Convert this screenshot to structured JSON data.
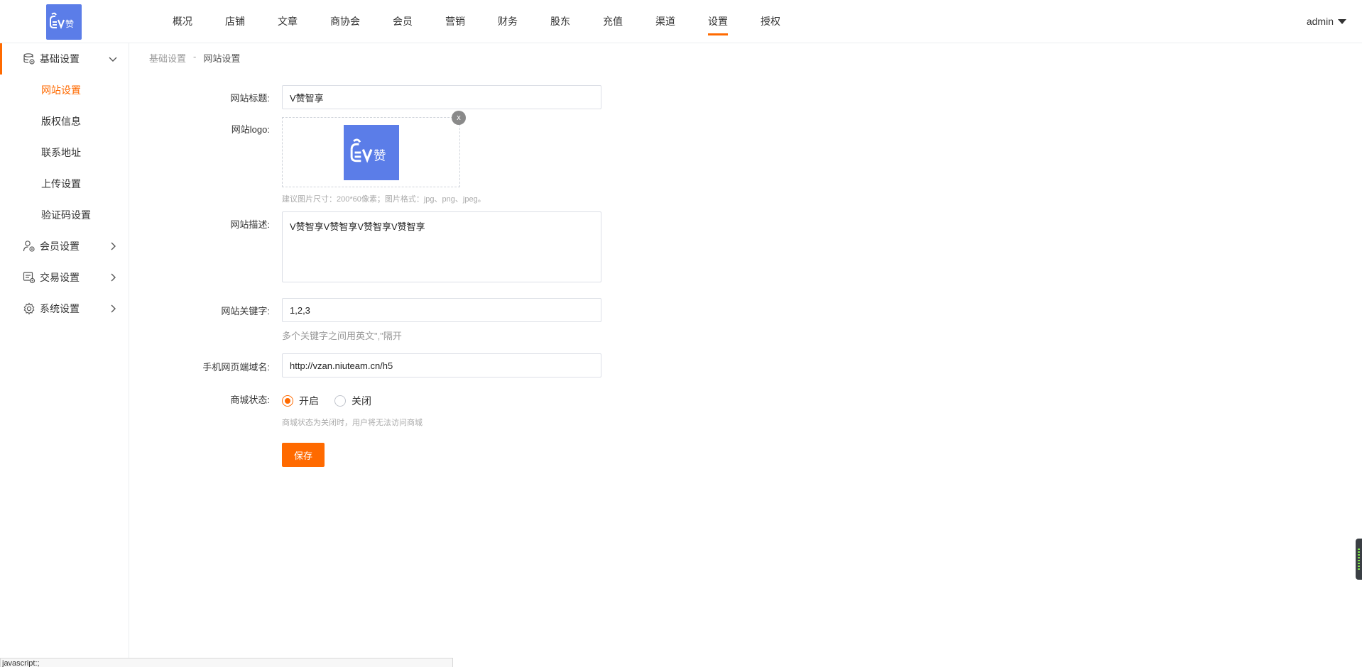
{
  "header": {
    "logo_text": "赞",
    "nav": [
      "概况",
      "店铺",
      "文章",
      "商协会",
      "会员",
      "营销",
      "财务",
      "股东",
      "充值",
      "渠道",
      "设置",
      "授权"
    ],
    "active_nav_index": 10,
    "user": "admin"
  },
  "sidebar": {
    "groups": [
      {
        "label": "基础设置",
        "icon": "database-gear-icon",
        "expanded": true,
        "items": [
          "网站设置",
          "版权信息",
          "联系地址",
          "上传设置",
          "验证码设置"
        ],
        "active_item_index": 0
      },
      {
        "label": "会员设置",
        "icon": "user-gear-icon",
        "expanded": false
      },
      {
        "label": "交易设置",
        "icon": "trade-icon",
        "expanded": false
      },
      {
        "label": "系统设置",
        "icon": "gear-icon",
        "expanded": false
      }
    ]
  },
  "breadcrumb": {
    "parent": "基础设置",
    "separator": "-",
    "current": "网站设置"
  },
  "form": {
    "title_label": "网站标题:",
    "title_value": "V赞智享",
    "logo_label": "网站logo:",
    "logo_close": "x",
    "logo_hint": "建议图片尺寸：200*60像素；图片格式：jpg、png、jpeg。",
    "desc_label": "网站描述:",
    "desc_value": "V赞智享V赞智享V赞智享V赞智享",
    "keywords_label": "网站关键字:",
    "keywords_value": "1,2,3",
    "keywords_hint": "多个关键字之间用英文\",\"隔开",
    "mobile_domain_label": "手机网页端域名:",
    "mobile_domain_value": "http://vzan.niuteam.cn/h5",
    "status_label": "商城状态:",
    "status_on": "开启",
    "status_off": "关闭",
    "status_selected": "开启",
    "status_hint": "商城状态为关闭时，用户将无法访问商城",
    "save_label": "保存"
  },
  "statusbar": {
    "text": "javascript:;"
  },
  "colors": {
    "accent": "#ff6a00",
    "logo_bg": "#5b7de8"
  }
}
